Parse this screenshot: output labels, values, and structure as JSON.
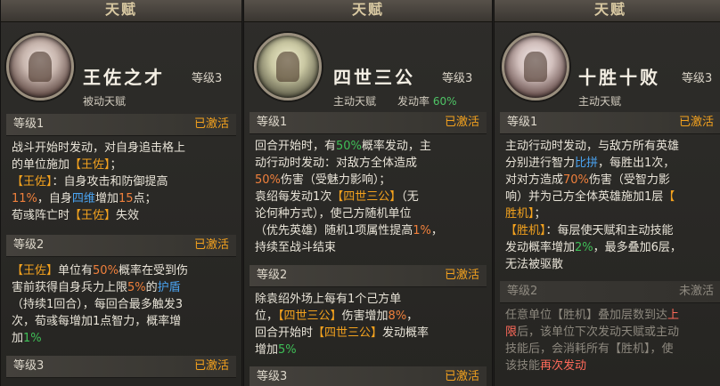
{
  "panels": [
    {
      "title": "天赋",
      "name": "王佐之才",
      "level": "等级3",
      "type": "被动天赋",
      "sections": [
        {
          "level": "等级1",
          "status": "已激活",
          "lines": [
            [
              "战斗开始时发动，对自身追击格上"
            ],
            [
              "的单位施加",
              "【王佐】",
              "；"
            ],
            [
              "【王佐】",
              "：自身攻击和防御提高"
            ],
            [
              "11%",
              "，自身",
              "四维",
              "增加",
              "15",
              "点；"
            ],
            [
              "荀彧阵亡时",
              "【王佐】",
              "失效"
            ]
          ]
        },
        {
          "level": "等级2",
          "status": "已激活",
          "lines": [
            [
              "【王佐】",
              "单位有",
              "50%",
              "概率在受到伤"
            ],
            [
              "害前获得自身兵力上限",
              "5%",
              "的",
              "护盾"
            ],
            [
              "（持续1回合），每回合最多触发3"
            ],
            [
              "次，荀彧每增加1点智力，概率增"
            ],
            [
              "加",
              "1%"
            ]
          ]
        },
        {
          "level": "等级3",
          "status": "已激活",
          "lines": []
        }
      ]
    },
    {
      "title": "天赋",
      "name": "四世三公",
      "level": "等级3",
      "type": "主动天赋",
      "rate_label": "发动率",
      "rate_value": "60%",
      "sections": [
        {
          "level": "等级1",
          "status": "已激活",
          "lines": [
            [
              "回合开始时，有",
              "50%",
              "概率发动，主"
            ],
            [
              "动行动时发动：对敌方全体造成"
            ],
            [
              "50%",
              "伤害（受魅力影响）；"
            ],
            [
              "袁绍每发动1次",
              "【四世三公】",
              "（无"
            ],
            [
              "论何种方式），使己方随机单位"
            ],
            [
              "（优先英雄）随机1项属性提高",
              "1%",
              "，"
            ],
            [
              "持续至战斗结束"
            ]
          ]
        },
        {
          "level": "等级2",
          "status": "已激活",
          "lines": [
            [
              "除袁绍外场上每有1个己方单"
            ],
            [
              "位，",
              "【四世三公】",
              "伤害增加",
              "8%",
              "，"
            ],
            [
              "回合开始时",
              "【四世三公】",
              "发动概率"
            ],
            [
              "增加",
              "5%"
            ]
          ]
        },
        {
          "level": "等级3",
          "status": "已激活",
          "lines": []
        }
      ]
    },
    {
      "title": "天赋",
      "name": "十胜十败",
      "level": "等级3",
      "type": "主动天赋",
      "sections": [
        {
          "level": "等级1",
          "status": "已激活",
          "lines": [
            [
              "主动行动时发动，与敌方所有英雄"
            ],
            [
              "分别进行智力",
              "比拼",
              "，每胜出1次，"
            ],
            [
              "对对方造成",
              "70%",
              "伤害（受智力影"
            ],
            [
              "响）并为己方全体英雄施加1层",
              "【"
            ],
            [
              "胜机】",
              "；"
            ],
            [
              "【胜机】",
              "：每层使天赋和主动技能"
            ],
            [
              "发动概率增加",
              "2%",
              "，最多叠加6层，"
            ],
            [
              "无法被驱散"
            ]
          ]
        },
        {
          "level": "等级2",
          "status": "未激活",
          "lines": [
            [
              "任意单位",
              "【胜机】",
              "叠加层数到达",
              "上"
            ],
            [
              "限",
              "后，该单位下次发动天赋或主动"
            ],
            [
              "技能后，会消耗所有",
              "【胜机】",
              "，使"
            ],
            [
              "该技能",
              "再次发动"
            ]
          ]
        }
      ]
    }
  ]
}
